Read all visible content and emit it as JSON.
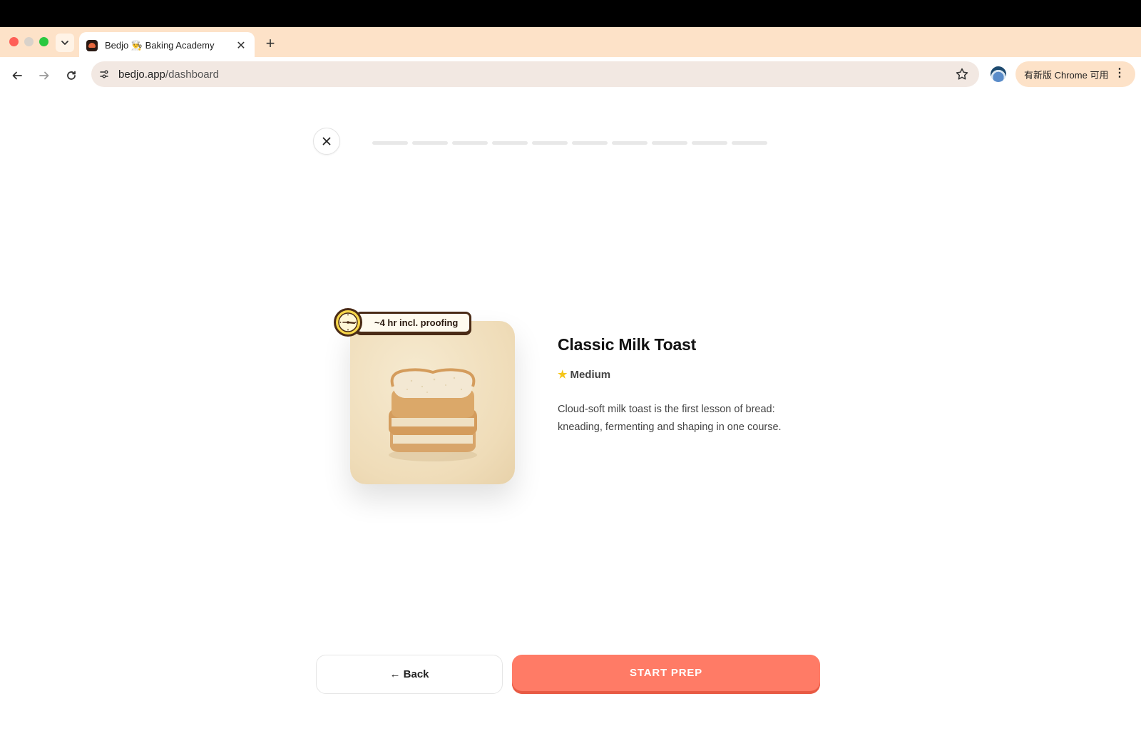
{
  "browser": {
    "tab_title": "Bedjo 👨‍🍳 Baking Academy",
    "url_domain": "bedjo.app",
    "url_path": "/dashboard",
    "update_label": "有新版 Chrome 可用"
  },
  "lesson": {
    "progress": {
      "total_steps": 10,
      "completed_steps": 0
    },
    "time_badge": "~4 hr incl. proofing",
    "title": "Classic Milk Toast",
    "difficulty": "Medium",
    "description": "Cloud-soft milk toast is the first lesson of bread: kneading, fermenting and shaping in one course.",
    "back_label": "← Back",
    "start_label": "START PREP"
  },
  "colors": {
    "accent": "#ff7b66",
    "chrome_bg": "#fde2c8",
    "badge_border": "#4a2b16",
    "clock_fill": "#f7d74a"
  },
  "icons": {
    "close": "close-icon",
    "clock": "clock-icon",
    "star": "star-icon",
    "bread": "bread-image"
  }
}
